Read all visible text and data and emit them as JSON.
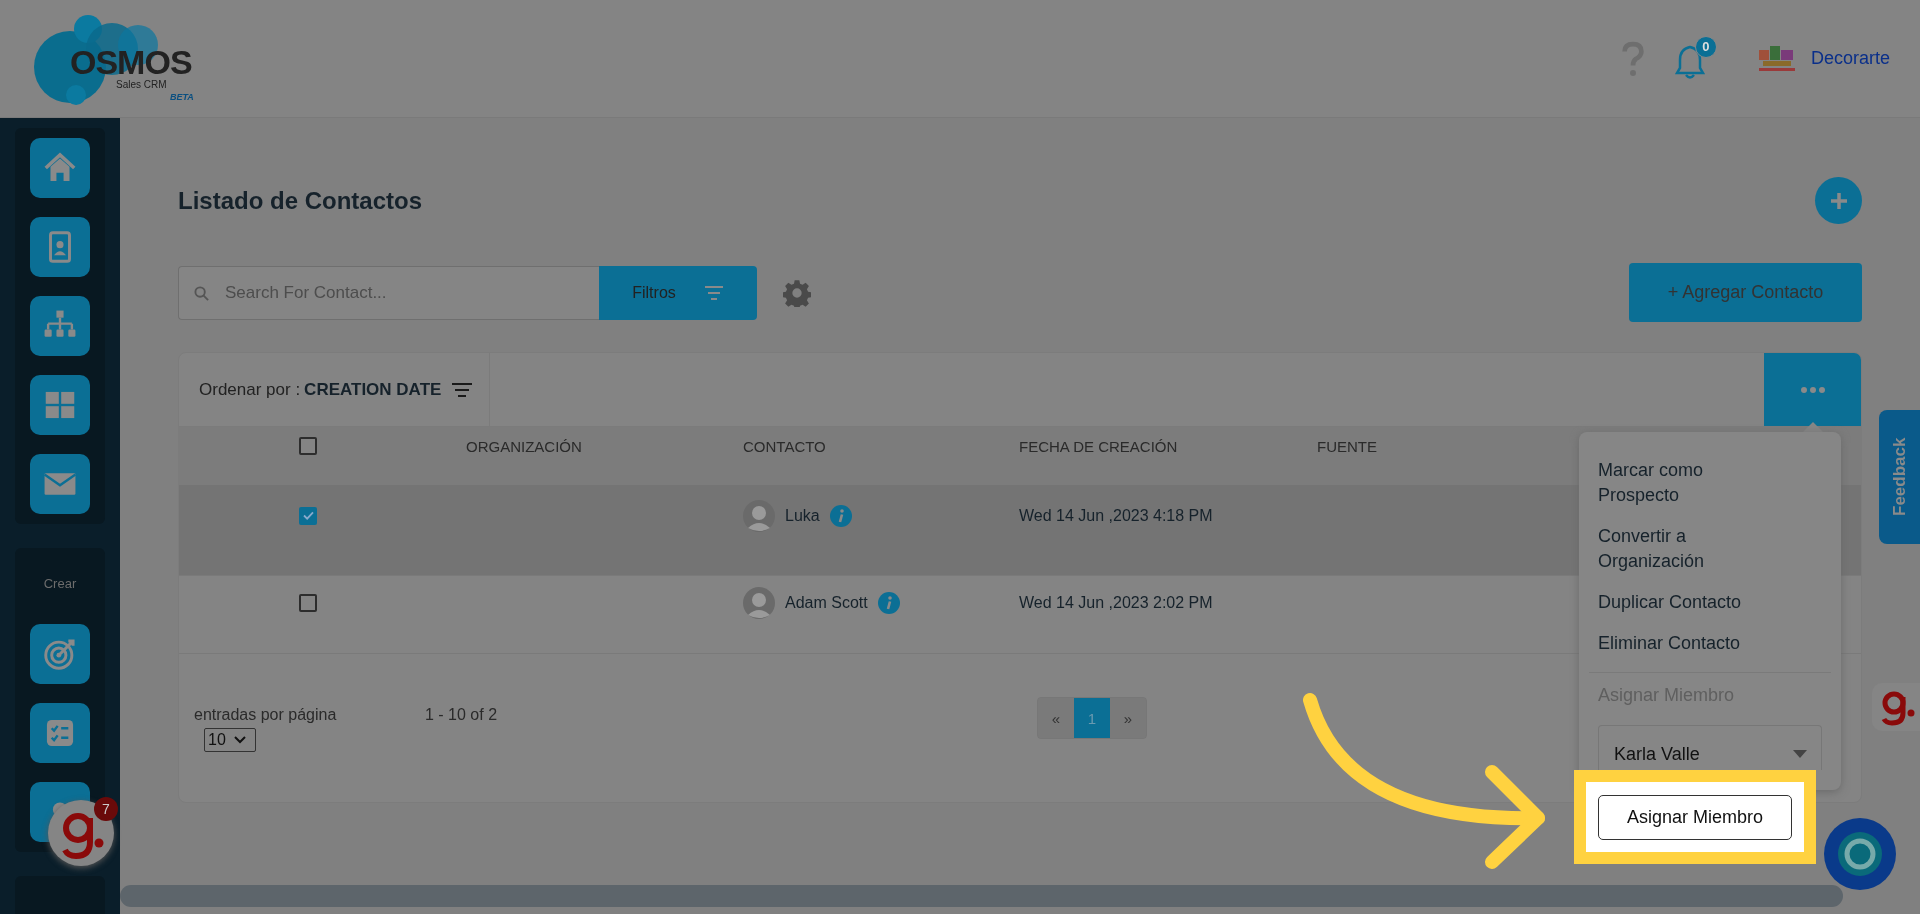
{
  "header": {
    "logo_text": "OSMOS",
    "logo_subtitle": "Sales CRM",
    "logo_badge": "BETA",
    "notification_count": "0",
    "account_name": "Decorarte"
  },
  "sidebar": {
    "nav_items": [
      {
        "kind": "home"
      },
      {
        "kind": "contact"
      },
      {
        "kind": "hierarchy"
      },
      {
        "kind": "grid"
      },
      {
        "kind": "mail"
      }
    ],
    "create_label": "Crear",
    "create_items": [
      {
        "kind": "target"
      },
      {
        "kind": "checklist"
      },
      {
        "kind": "other"
      }
    ]
  },
  "page": {
    "title": "Listado de Contactos",
    "search_placeholder": "Search For Contact...",
    "filter_button": "Filtros",
    "add_button": "+ Agregar Contacto"
  },
  "sort": {
    "label": "Ordenar por :",
    "value": "CREATION DATE"
  },
  "table": {
    "all_checked": false,
    "columns": [
      "ORGANIZACIÓN",
      "CONTACTO",
      "FECHA DE CREACIÓN",
      "FUENTE"
    ],
    "rows": [
      {
        "checked": true,
        "contact": "Luka",
        "created": "Wed 14 Jun ,2023 4:18 PM"
      },
      {
        "checked": false,
        "contact": "Adam Scott",
        "created": "Wed 14 Jun ,2023 2:02 PM"
      }
    ]
  },
  "footer": {
    "per_page_label": "entradas por página",
    "per_page": "10",
    "range": "1 - 10 of 2",
    "pages": [
      {
        "label": "«",
        "selected": false
      },
      {
        "label": "1",
        "selected": true
      },
      {
        "label": "»",
        "selected": false
      }
    ]
  },
  "action_menu": {
    "items": [
      {
        "kind": "action",
        "label": "Marcar como Prospecto"
      },
      {
        "kind": "action",
        "label": "Convertir a Organización"
      },
      {
        "kind": "action",
        "label": "Duplicar Contacto"
      },
      {
        "kind": "action",
        "label": "Eliminar Contacto"
      },
      {
        "kind": "heading",
        "label": "Asignar Miembro"
      }
    ],
    "member_select": "Karla Valle",
    "assign_button": "Asignar Miembro"
  },
  "widgets": {
    "feedback_tab": "Feedback",
    "helper_badge": "7"
  }
}
